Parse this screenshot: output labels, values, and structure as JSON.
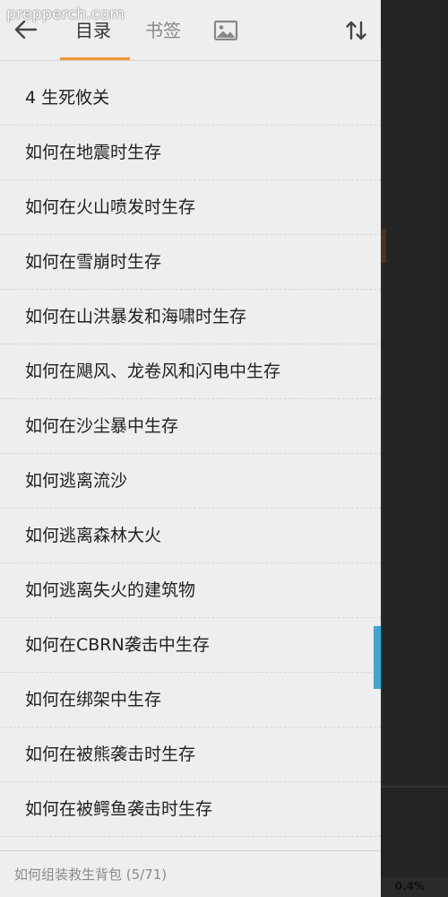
{
  "watermark": "prepperch.com",
  "header": {
    "tabs": [
      {
        "label": "目录",
        "active": true
      },
      {
        "label": "书签",
        "active": false
      }
    ],
    "icons": {
      "back": "arrow-left-icon",
      "image_tab": "image-icon",
      "sort": "sort-icon"
    },
    "accent_color": "#f0962e"
  },
  "toc": {
    "items": [
      "4 生死攸关",
      "如何在地震时生存",
      "如何在火山喷发时生存",
      "如何在雪崩时生存",
      "如何在山洪暴发和海啸时生存",
      "如何在飓风、龙卷风和闪电中生存",
      "如何在沙尘暴中生存",
      "如何逃离流沙",
      "如何逃离森林大火",
      "如何逃离失火的建筑物",
      "如何在CBRN袭击中生存",
      "如何在绑架中生存",
      "如何在被熊袭击时生存",
      "如何在被鳄鱼袭击时生存"
    ],
    "scroll_indicator_color": "#3da6d2"
  },
  "footer": {
    "current_chapter": "如何组装救生背包 (5/71)"
  },
  "reader": {
    "progress": "0.4%"
  }
}
